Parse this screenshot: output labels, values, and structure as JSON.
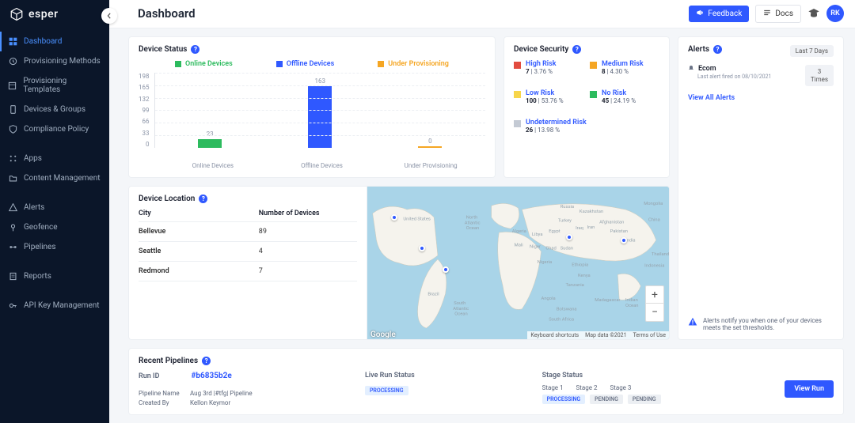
{
  "brand": "esper",
  "page_title": "Dashboard",
  "topbar": {
    "feedback": "Feedback",
    "docs": "Docs",
    "avatar_initials": "RK"
  },
  "sidebar": {
    "items": [
      {
        "label": "Dashboard",
        "icon": "dashboard-icon",
        "active": true
      },
      {
        "label": "Provisioning Methods",
        "icon": "provision-method-icon"
      },
      {
        "label": "Provisioning Templates",
        "icon": "provision-template-icon"
      },
      {
        "label": "Devices & Groups",
        "icon": "devices-icon"
      },
      {
        "label": "Compliance Policy",
        "icon": "compliance-icon"
      },
      {
        "gap": true
      },
      {
        "label": "Apps",
        "icon": "apps-icon"
      },
      {
        "label": "Content Management",
        "icon": "content-icon"
      },
      {
        "gap": true
      },
      {
        "label": "Alerts",
        "icon": "alerts-icon"
      },
      {
        "label": "Geofence",
        "icon": "geofence-icon"
      },
      {
        "label": "Pipelines",
        "icon": "pipelines-icon"
      },
      {
        "gap": true
      },
      {
        "label": "Reports",
        "icon": "reports-icon"
      },
      {
        "gap": true
      },
      {
        "label": "API Key Management",
        "icon": "api-key-icon"
      }
    ]
  },
  "device_status": {
    "title": "Device Status",
    "legend": {
      "online": "Online Devices",
      "offline": "Offline Devices",
      "provisioning": "Under Provisioning"
    }
  },
  "chart_data": {
    "type": "bar",
    "categories": [
      "Online Devices",
      "Offline Devices",
      "Under Provisioning"
    ],
    "values": [
      23,
      163,
      0
    ],
    "yticks": [
      198,
      165,
      132,
      99,
      66,
      33,
      0
    ],
    "ylim": [
      0,
      198
    ],
    "colors": [
      "#2dbb5e",
      "#2f58ff",
      "#f5a623"
    ]
  },
  "device_security": {
    "title": "Device Security",
    "risks": [
      {
        "label": "High Risk",
        "count": 7,
        "pct": "3.76 %",
        "color": "#e24c3f"
      },
      {
        "label": "Medium Risk",
        "count": 8,
        "pct": "4.30 %",
        "color": "#f5a623"
      },
      {
        "label": "Low Risk",
        "count": 100,
        "pct": "53.76 %",
        "color": "#f7d54a"
      },
      {
        "label": "No Risk",
        "count": 45,
        "pct": "24.19 %",
        "color": "#2dbb5e"
      },
      {
        "label": "Undetermined Risk",
        "count": 26,
        "pct": "13.98 %",
        "color": "#c4cad4",
        "full": true
      }
    ]
  },
  "alerts": {
    "title": "Alerts",
    "period": "Last 7 Days",
    "item": {
      "name": "Ecom",
      "sub": "Last alert fired on 08/10/2021",
      "count": "3",
      "unit": "Times"
    },
    "view_all": "View All Alerts",
    "footer": "Alerts notify you when one of your devices meets the set thresholds."
  },
  "location": {
    "title": "Device Location",
    "col_city": "City",
    "col_count": "Number of Devices",
    "rows": [
      {
        "city": "Bellevue",
        "count": 89
      },
      {
        "city": "Seattle",
        "count": 4
      },
      {
        "city": "Redmond",
        "count": 7
      }
    ],
    "map": {
      "logo": "Google",
      "shortcuts": "Keyboard shortcuts",
      "data": "Map data ©2021",
      "terms": "Terms of Use"
    }
  },
  "pipelines": {
    "title": "Recent Pipelines",
    "run_id_label": "Run ID",
    "run_id": "#b6835b2e",
    "meta": {
      "name_label": "Pipeline Name",
      "name_value": "Aug 3rd |#tfg| Pipeline",
      "created_label": "Created By",
      "created_value": "Kellon Keymor"
    },
    "live_status_label": "Live Run Status",
    "live_status": "PROCESSING",
    "stage_status_label": "Stage Status",
    "stages": [
      "Stage 1",
      "Stage 2",
      "Stage 3"
    ],
    "stage_values": [
      "PROCESSING",
      "PENDING",
      "PENDING"
    ],
    "view_run": "View Run"
  }
}
